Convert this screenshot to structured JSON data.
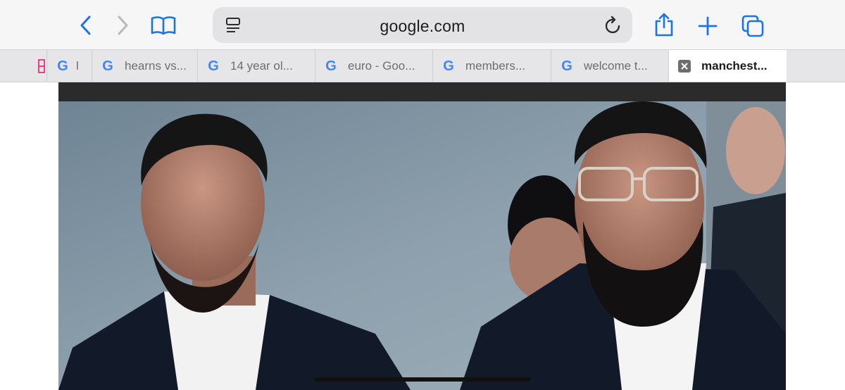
{
  "toolbar": {
    "address": "google.com",
    "icons": {
      "back": "chevron-left-icon",
      "forward": "chevron-right-icon",
      "bookmarks": "book-icon",
      "reader": "reader-icon",
      "reload": "reload-icon",
      "share": "share-icon",
      "new_tab": "plus-icon",
      "tabs": "tabs-overview-icon"
    },
    "accent_color": "#1a73e8"
  },
  "tabs": [
    {
      "title": "",
      "favicon": "pinned-icon"
    },
    {
      "title": "l",
      "favicon": "google-icon"
    },
    {
      "title": "hearns vs...",
      "favicon": "google-icon"
    },
    {
      "title": "14 year ol...",
      "favicon": "google-icon"
    },
    {
      "title": "euro - Goo...",
      "favicon": "google-icon"
    },
    {
      "title": "members...",
      "favicon": "google-icon"
    },
    {
      "title": "welcome t...",
      "favicon": "google-icon"
    },
    {
      "title": "manchest...",
      "favicon": "close-icon",
      "active": true
    }
  ]
}
